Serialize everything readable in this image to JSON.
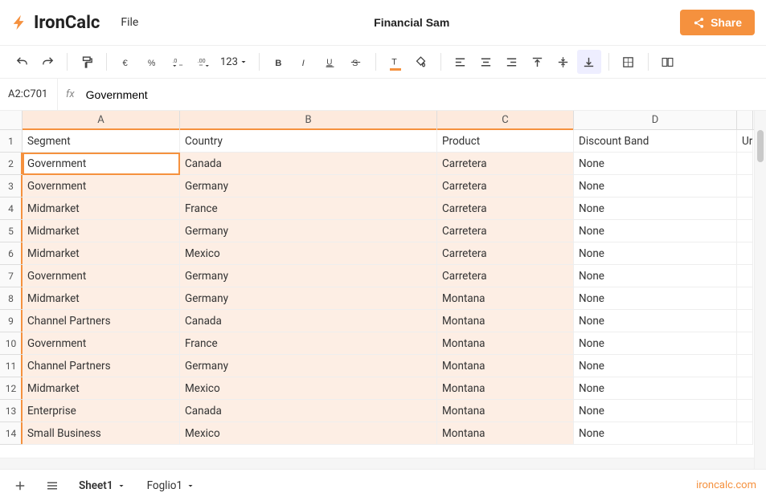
{
  "app": {
    "name": "IronCalc",
    "brand_link": "ironcalc.com"
  },
  "header": {
    "file_menu": "File",
    "doc_name": "Financial Sam",
    "share_label": "Share"
  },
  "formula_bar": {
    "cell_ref": "A2:C701",
    "fx_label": "fx",
    "value": "Government"
  },
  "columns": [
    "A",
    "B",
    "C",
    "D"
  ],
  "col_e_partial": "Ur",
  "headers_row": [
    "Segment",
    "Country",
    "Product",
    "Discount Band"
  ],
  "rows": [
    {
      "n": 1,
      "cells": [
        "Segment",
        "Country",
        "Product",
        "Discount Band"
      ],
      "header": true
    },
    {
      "n": 2,
      "cells": [
        "Government",
        "Canada",
        "Carretera",
        "None"
      ]
    },
    {
      "n": 3,
      "cells": [
        "Government",
        "Germany",
        "Carretera",
        "None"
      ]
    },
    {
      "n": 4,
      "cells": [
        "Midmarket",
        "France",
        "Carretera",
        "None"
      ]
    },
    {
      "n": 5,
      "cells": [
        "Midmarket",
        "Germany",
        "Carretera",
        "None"
      ]
    },
    {
      "n": 6,
      "cells": [
        "Midmarket",
        "Mexico",
        "Carretera",
        "None"
      ]
    },
    {
      "n": 7,
      "cells": [
        "Government",
        "Germany",
        "Carretera",
        "None"
      ]
    },
    {
      "n": 8,
      "cells": [
        "Midmarket",
        "Germany",
        "Montana",
        "None"
      ]
    },
    {
      "n": 9,
      "cells": [
        "Channel Partners",
        "Canada",
        "Montana",
        "None"
      ]
    },
    {
      "n": 10,
      "cells": [
        "Government",
        "France",
        "Montana",
        "None"
      ]
    },
    {
      "n": 11,
      "cells": [
        "Channel Partners",
        "Germany",
        "Montana",
        "None"
      ]
    },
    {
      "n": 12,
      "cells": [
        "Midmarket",
        "Mexico",
        "Montana",
        "None"
      ]
    },
    {
      "n": 13,
      "cells": [
        "Enterprise",
        "Canada",
        "Montana",
        "None"
      ]
    },
    {
      "n": 14,
      "cells": [
        "Small Business",
        "Mexico",
        "Montana",
        "None"
      ]
    }
  ],
  "number_format": "123",
  "sheets": [
    {
      "name": "Sheet1",
      "active": true
    },
    {
      "name": "Foglio1",
      "active": false
    }
  ],
  "selection": {
    "active_cell": "A2",
    "sel_cols": [
      "A",
      "B",
      "C"
    ],
    "sel_rows_from": 2
  }
}
